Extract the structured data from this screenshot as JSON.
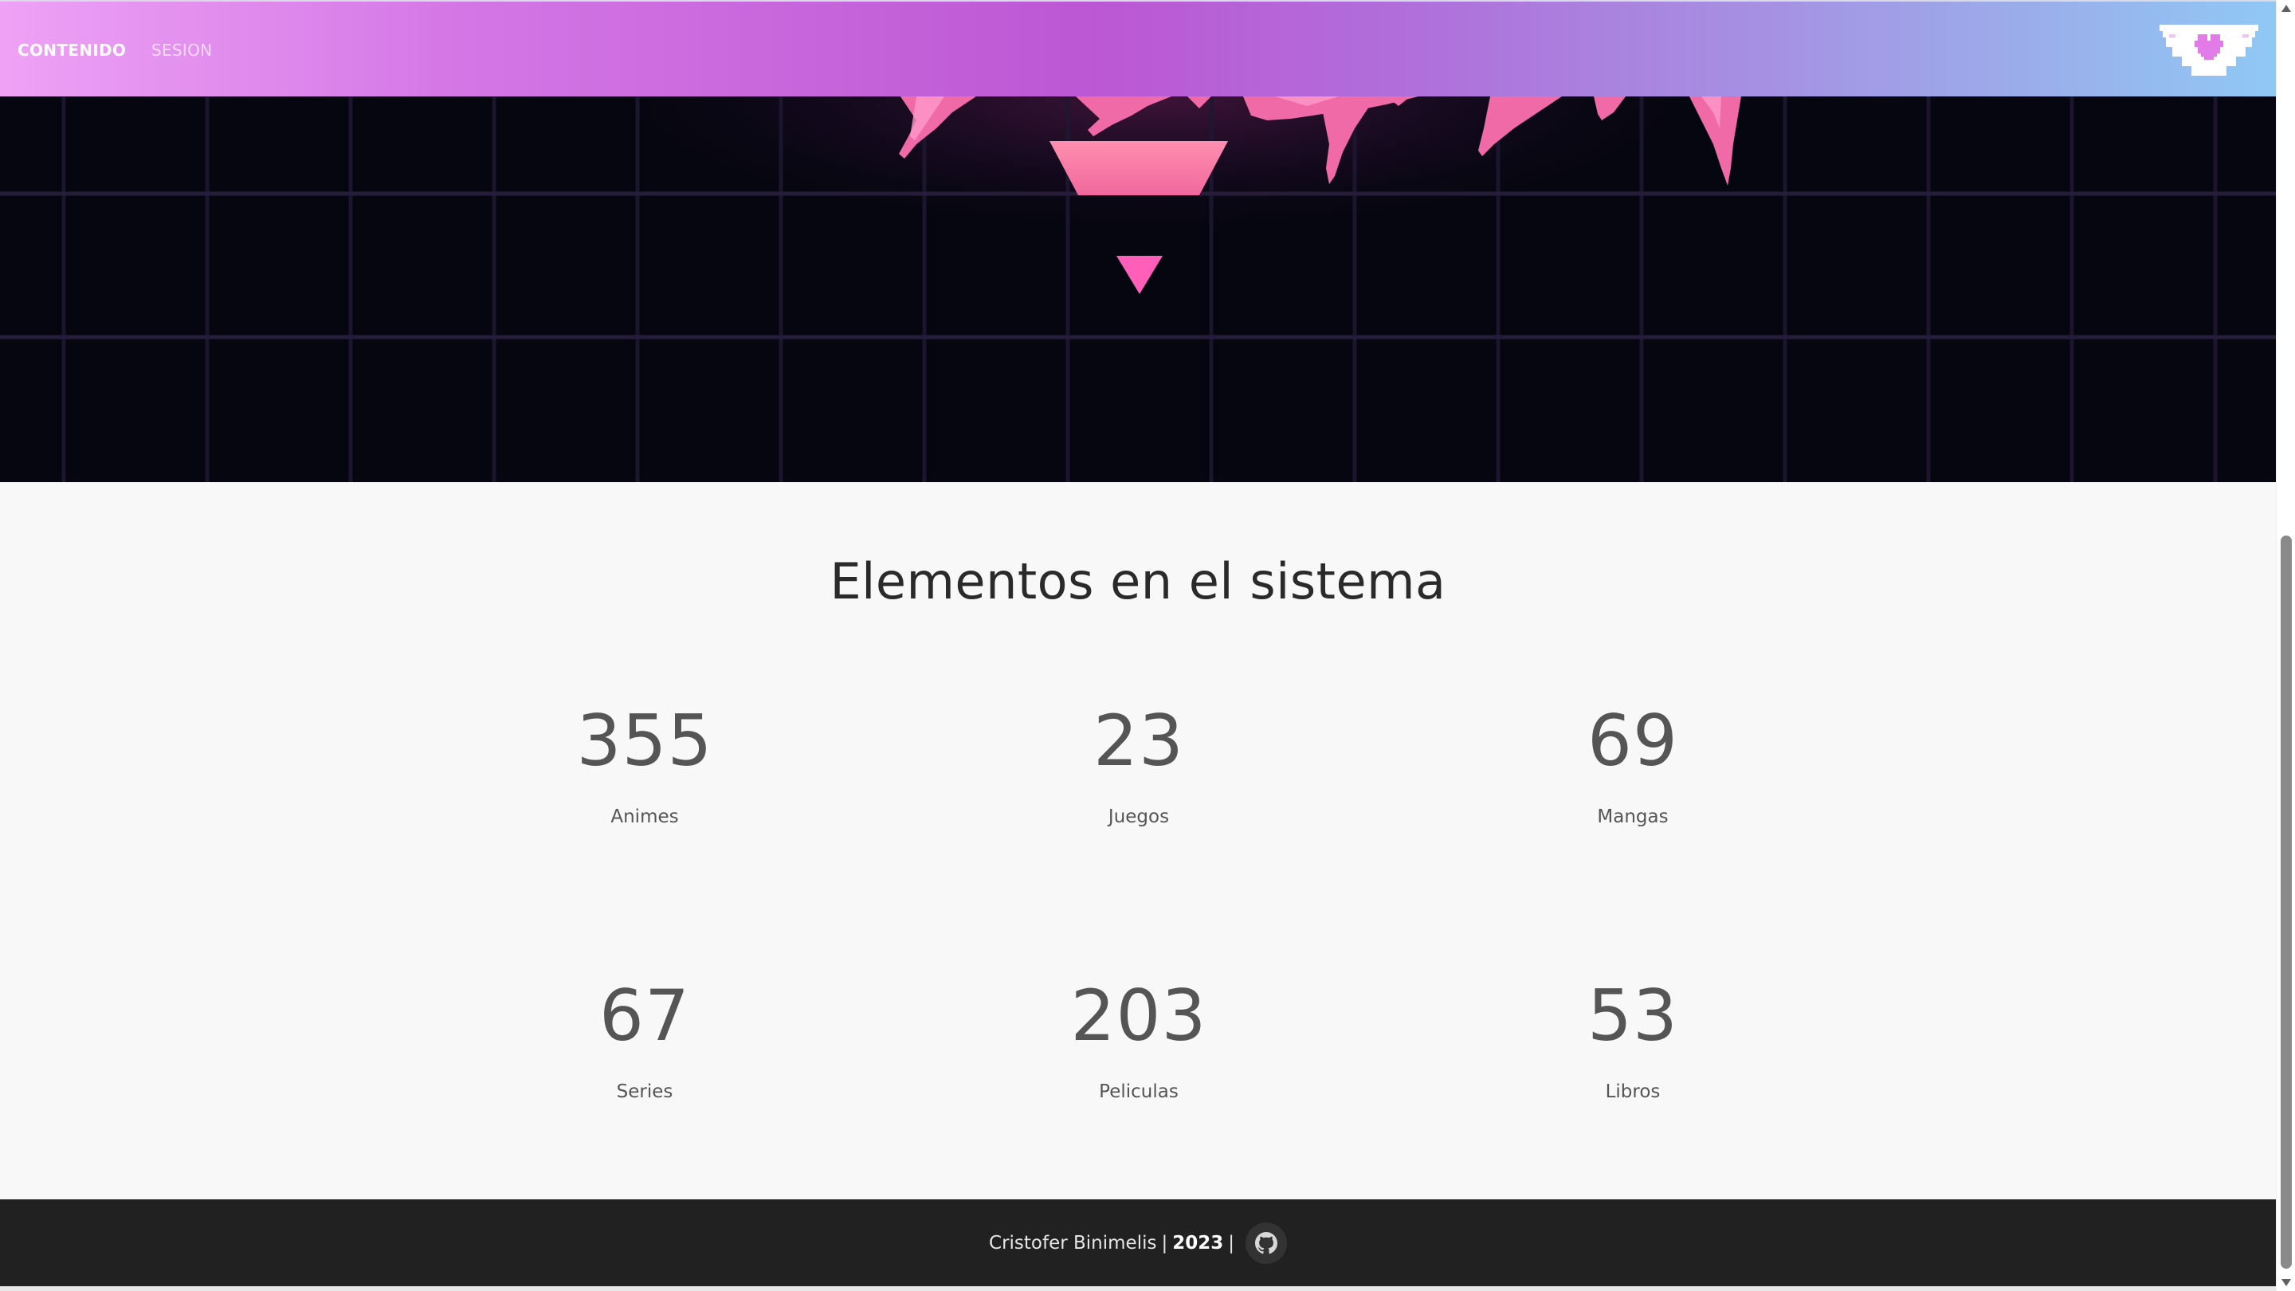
{
  "navbar": {
    "links": [
      {
        "label": "CONTENIDO",
        "active": true
      },
      {
        "label": "SESION",
        "active": false
      }
    ],
    "logo_icon": "pixel-heart-shield-icon",
    "gradient": [
      "#eea2f5",
      "#bc57d3",
      "#90c8f4"
    ]
  },
  "hero": {
    "background_color": "#05060f",
    "grid_color": "#241a3a",
    "accent_color": "#ff6fa8",
    "icons": [
      "pink-brush-strokes",
      "pink-trapezoid",
      "pink-down-triangle"
    ]
  },
  "stats": {
    "title": "Elementos en el sistema",
    "items": [
      {
        "value": "355",
        "label": "Animes"
      },
      {
        "value": "23",
        "label": "Juegos"
      },
      {
        "value": "69",
        "label": "Mangas"
      },
      {
        "value": "67",
        "label": "Series"
      },
      {
        "value": "203",
        "label": "Peliculas"
      },
      {
        "value": "53",
        "label": "Libros"
      }
    ]
  },
  "footer": {
    "author": "Cristofer Binimelis",
    "separator": "|",
    "year": "2023",
    "github_icon": "github-icon"
  }
}
